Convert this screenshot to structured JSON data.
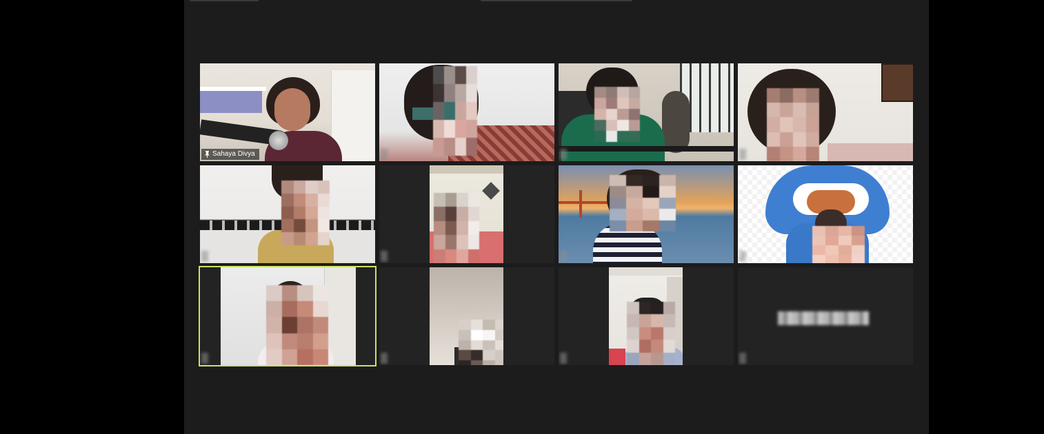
{
  "meeting": {
    "view": "gallery",
    "accent_active_speaker": "#c9e265",
    "participants": [
      {
        "name": "Sahaya Divya",
        "pinned": true,
        "video": "on"
      },
      {
        "name": "",
        "video": "on"
      },
      {
        "name": "",
        "video": "on"
      },
      {
        "name": "",
        "video": "on"
      },
      {
        "name": "",
        "video": "on"
      },
      {
        "name": "",
        "video": "on"
      },
      {
        "name": "",
        "video": "on"
      },
      {
        "name": "",
        "video": "on"
      },
      {
        "name": "",
        "video": "on",
        "active_speaker": true
      },
      {
        "name": "",
        "video": "on"
      },
      {
        "name": "",
        "video": "on"
      },
      {
        "name": "",
        "video": "off"
      }
    ]
  },
  "icons": {
    "pin": "pin-icon"
  }
}
